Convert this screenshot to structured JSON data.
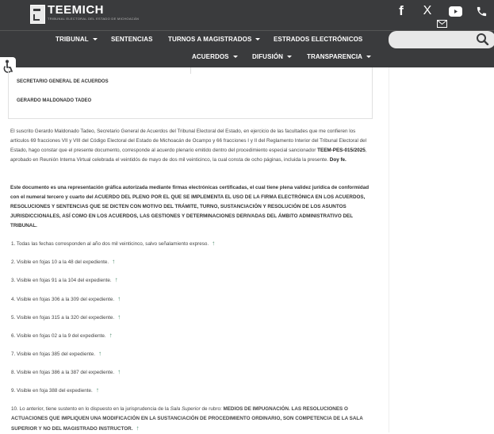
{
  "header": {
    "logo_title": "TEEMICH",
    "logo_sub": "TRIBUNAL ELECTORAL DEL ESTADO DE MICHOACÁN"
  },
  "social": {
    "facebook": "f",
    "x": "X",
    "youtube": "youtube",
    "phone": "phone",
    "mail": "mail"
  },
  "nav": {
    "tribunal": "TRIBUNAL",
    "sentencias": "SENTENCIAS",
    "turnos": "TURNOS A MAGISTRADOS",
    "estrados": "ESTRADOS ELECTRÓNICOS",
    "acuerdos": "ACUERDOS",
    "difusion": "DIFUSIÓN",
    "transparencia": "TRANSPARENCIA"
  },
  "search": {
    "placeholder": ""
  },
  "signature": {
    "role": "SECRETARIO GENERAL DE ACUERDOS",
    "name": "GERARDO MALDONADO TADEO"
  },
  "body": {
    "p1_a": "El suscrito Gerardo Maldonado Tadeo, Secretario General de Acuerdos del Tribunal Electoral del Estado, en ejercicio de las facultades que me confieren los artículos 69 fracciones VII y VIII del Código Electoral del Estado de Michoacán de Ocampo y 66 fracciones I y II del Reglamento Interior del Tribunal Electoral del Estado, hago constar que el presente documento, corresponde al acuerdo plenario emitido dentro del procedimiento especial sancionador ",
    "p1_case": "TEEM-PES-015/2025",
    "p1_b": ", aprobado en Reunión Interna Virtual celebrada el veintidós de mayo de dos mil veinticinco, la cual consta de ocho páginas, incluida la presente. ",
    "p1_c": "Doy fe.",
    "p2": "Este documento es una representación gráfica autorizada mediante firmas electrónicas certificadas, el cual tiene plena validez jurídica de conformidad con el numeral tercero y cuarto del ACUERDO DEL PLENO POR EL QUE SE IMPLEMENTA EL USO DE LA FIRMA ELECTRÓNICA EN LOS ACUERDOS, RESOLUCIONES Y SENTENCIAS QUE SE DICTEN CON MOTIVO DEL TRÁMITE, TURNO, SUSTANCIACIÓN Y RESOLUCIÓN DE LOS ASUNTOS JURISDICCIONALES, ASÍ COMO EN LOS ACUERDOS, LAS GESTIONES Y DETERMINACIONES DERIVADAS DEL ÁMBITO ADMINISTRATIVO DEL TRIBUNAL."
  },
  "footnotes": [
    "1. Todas las fechas corresponden al año dos mil veinticinco, salvo señalamiento expreso.",
    "2. Visible en fojas 10 a la 48 del expediente.",
    "3. Visible en fojas 91 a la 104 del expediente.",
    "4. Visible en fojas 306 a la 309 del expediente.",
    "5. Visible en fojas 315 a la 320 del expediente.",
    "6. Visible en fojas 02 a la 9 del expediente.",
    "7. Visible en fojas 385 del expediente.",
    "8. Visible en fojas 386 a la 387 del expediente.",
    "9. Visible en foja 388 del expediente."
  ],
  "footnote10": {
    "a": "10. Lo anterior, tiene sustento en lo dispuesto en la jurisprudencia de la ",
    "b": "Sala Superior",
    "c": " de rubro: ",
    "d": "MEDIOS DE IMPUGNACIÓN. LAS RESOLUCIONES O ACTUACIONES QUE IMPLIQUEN UNA MODIFICACIÓN EN LA SUSTANCIACIÓN DE PROCEDIMIENTO ORDINARIO, SON COMPETENCIA DE LA SALA SUPERIOR Y NO DEL MAGISTRADO INSTRUCTOR."
  },
  "back_arrow": "↑",
  "colors": {
    "header_bg": "#3a3b3d",
    "link_green": "#4c8c6c"
  }
}
